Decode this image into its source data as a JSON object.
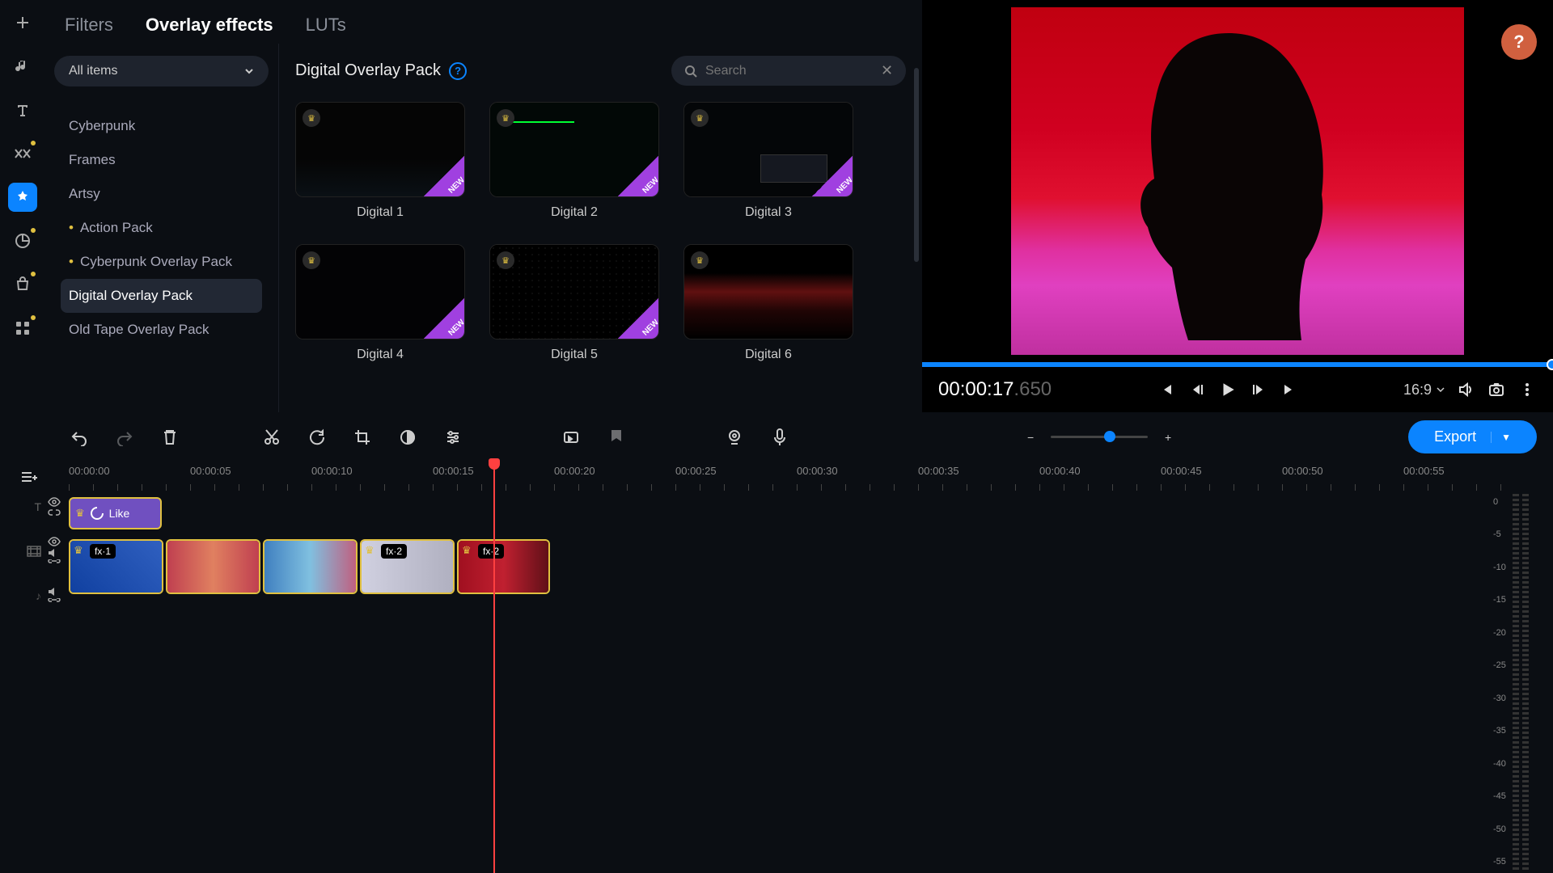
{
  "tabs": {
    "filters": "Filters",
    "overlay": "Overlay effects",
    "luts": "LUTs"
  },
  "sidebar": {
    "dropdown": "All items",
    "categories": [
      {
        "label": "Cyberpunk",
        "bullet": false
      },
      {
        "label": "Frames",
        "bullet": false
      },
      {
        "label": "Artsy",
        "bullet": false
      },
      {
        "label": "Action Pack",
        "bullet": true
      },
      {
        "label": "Cyberpunk Overlay Pack",
        "bullet": true
      },
      {
        "label": "Digital Overlay Pack",
        "bullet": false,
        "selected": true
      },
      {
        "label": "Old Tape Overlay Pack",
        "bullet": false
      }
    ]
  },
  "content": {
    "title": "Digital Overlay Pack",
    "search_placeholder": "Search",
    "items": [
      "Digital 1",
      "Digital 2",
      "Digital 3",
      "Digital 4",
      "Digital 5",
      "Digital 6"
    ],
    "new_badge": "NEW"
  },
  "preview": {
    "timecode": "00:00:17",
    "timecode_ms": ".650",
    "ratio": "16:9"
  },
  "toolbar": {
    "export": "Export"
  },
  "ruler": [
    "00:00:00",
    "00:00:05",
    "00:00:10",
    "00:00:15",
    "00:00:20",
    "00:00:25",
    "00:00:30",
    "00:00:35",
    "00:00:40",
    "00:00:45",
    "00:00:50",
    "00:00:55"
  ],
  "timeline": {
    "title_clip": "Like",
    "fx1": "fx·1",
    "fx2": "fx·2"
  },
  "meter_labels": [
    "0",
    "-5",
    "-10",
    "-15",
    "-20",
    "-25",
    "-30",
    "-35",
    "-40",
    "-45",
    "-50",
    "-55"
  ],
  "colors": {
    "accent": "#0b84ff",
    "gold": "#e0c040",
    "purple": "#a040e0"
  }
}
